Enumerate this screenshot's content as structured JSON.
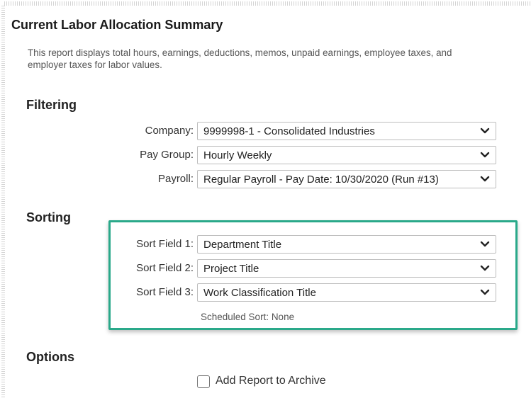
{
  "report": {
    "title": "Current Labor Allocation Summary",
    "description": "This report displays total hours, earnings, deductions, memos, unpaid earnings, employee taxes, and employer taxes for labor values."
  },
  "filtering": {
    "heading": "Filtering",
    "company": {
      "label": "Company:",
      "value": "9999998-1 - Consolidated Industries"
    },
    "pay_group": {
      "label": "Pay Group:",
      "value": "Hourly Weekly"
    },
    "payroll": {
      "label": "Payroll:",
      "value": "Regular Payroll - Pay Date: 10/30/2020 (Run #13)"
    }
  },
  "sorting": {
    "heading": "Sorting",
    "sort_field_1": {
      "label": "Sort Field 1:",
      "value": "Department Title"
    },
    "sort_field_2": {
      "label": "Sort Field 2:",
      "value": "Project Title"
    },
    "sort_field_3": {
      "label": "Sort Field 3:",
      "value": "Work Classification Title"
    },
    "scheduled_sort": "Scheduled Sort: None"
  },
  "options": {
    "heading": "Options",
    "add_to_archive": {
      "label": "Add Report to Archive",
      "checked": false
    }
  },
  "colors": {
    "highlight": "#2aa98a",
    "text": "#333333",
    "border": "#bdbdbd"
  },
  "icons": {
    "dropdown": "chevron-down-icon"
  }
}
